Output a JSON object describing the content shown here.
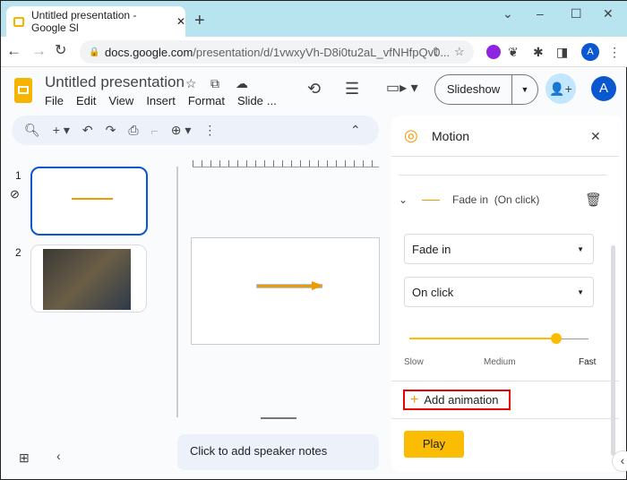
{
  "browser": {
    "tab_title": "Untitled presentation - Google Sl",
    "new_tab": "+",
    "url_host": "docs.google.com",
    "url_path": "/presentation/d/1vwxyVh-D8i0tu2aL_vfNHfpQv0...",
    "profile": "A"
  },
  "app": {
    "title": "Untitled presentation",
    "menu": [
      "File",
      "Edit",
      "View",
      "Insert",
      "Format",
      "Slide",
      "..."
    ],
    "slideshow": "Slideshow",
    "avatar": "A"
  },
  "slides": [
    {
      "number": "1"
    },
    {
      "number": "2"
    }
  ],
  "notes_placeholder": "Click to add speaker notes",
  "motion": {
    "title": "Motion",
    "animation_summary": "Fade in",
    "animation_trigger": "(On click)",
    "effect": "Fade in",
    "trigger": "On click",
    "speed_labels": [
      "Slow",
      "Medium",
      "Fast"
    ],
    "speed_value": 0.82,
    "add_animation": "Add animation",
    "play": "Play",
    "accent": "#fbbc04"
  }
}
